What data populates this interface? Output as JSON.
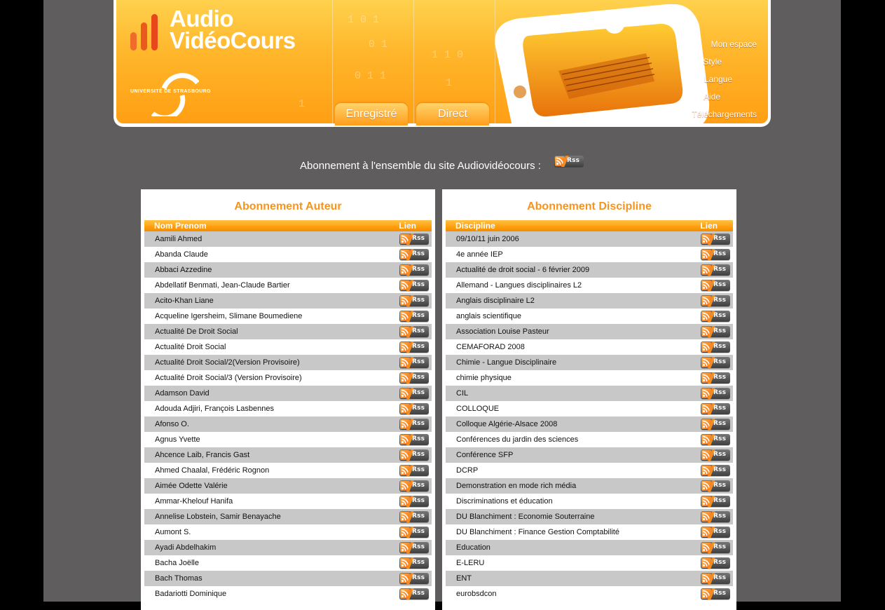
{
  "brand": {
    "line1": "Audio",
    "line2": "VidéoCours",
    "university": "UNIVERSITÉ DE STRASBOURG",
    "accent": "#f7941d"
  },
  "nav": {
    "tabs": [
      "Enregistré",
      "Direct"
    ],
    "menu": [
      "Mon espace",
      "Style",
      "Langue",
      "Aide",
      "Téléchargements"
    ]
  },
  "site_subscription": {
    "text": "Abonnement à l'ensemble du site Audiovidéocours :",
    "badge": "Rss"
  },
  "rss_label": "Rss",
  "auteur": {
    "title": "Abonnement Auteur",
    "col_name": "Nom Prenom",
    "col_link": "Lien",
    "rows": [
      "Aamili Ahmed",
      "Abanda Claude",
      "Abbaci Azzedine",
      "Abdellatif Benmati, Jean-Claude Bartier",
      "Acito-Khan Liane",
      "Acqueline Igersheim, Slimane Boumediene",
      "Actualité De Droit Social",
      "Actualité Droit Social",
      "Actualité Droit Social/2(Version Provisoire)",
      "Actualité Droit Social/3 (Version Provisoire)",
      "Adamson David",
      "Adouda Adjiri, François Lasbennes",
      "Afonso O.",
      "Agnus Yvette",
      "Ahcence Laib, Francis Gast",
      "Ahmed Chaalal, Frédéric Rognon",
      "Aimée Odette Valérie",
      "Ammar-Khelouf Hanifa",
      "Annelise Lobstein, Samir Benayache",
      "Aumont S.",
      "Ayadi Abdelhakim",
      "Bacha Joëlle",
      "Bach Thomas",
      "Badariotti Dominique"
    ]
  },
  "discipline": {
    "title": "Abonnement Discipline",
    "col_name": "Discipline",
    "col_link": "Lien",
    "rows": [
      "09/10/11 juin 2006",
      "4e année IEP",
      "Actualité de droit social - 6 février 2009",
      "Allemand - Langues disciplinaires L2",
      "Anglais disciplinaire L2",
      "anglais scientifique",
      "Association Louise Pasteur",
      "CEMAFORAD 2008",
      "Chimie - Langue Disciplinaire",
      "chimie physique",
      "CIL",
      "COLLOQUE",
      "Colloque Algérie-Alsace 2008",
      "Conférences du jardin des sciences",
      "Conférence SFP",
      "DCRP",
      "Demonstration en mode rich média",
      "Discriminations et éducation",
      "DU Blanchiment : Economie Souterraine",
      "DU Blanchiment : Finance Gestion Comptabilité",
      "Education",
      "E-LERU",
      "ENT",
      "eurobsdcon"
    ]
  }
}
